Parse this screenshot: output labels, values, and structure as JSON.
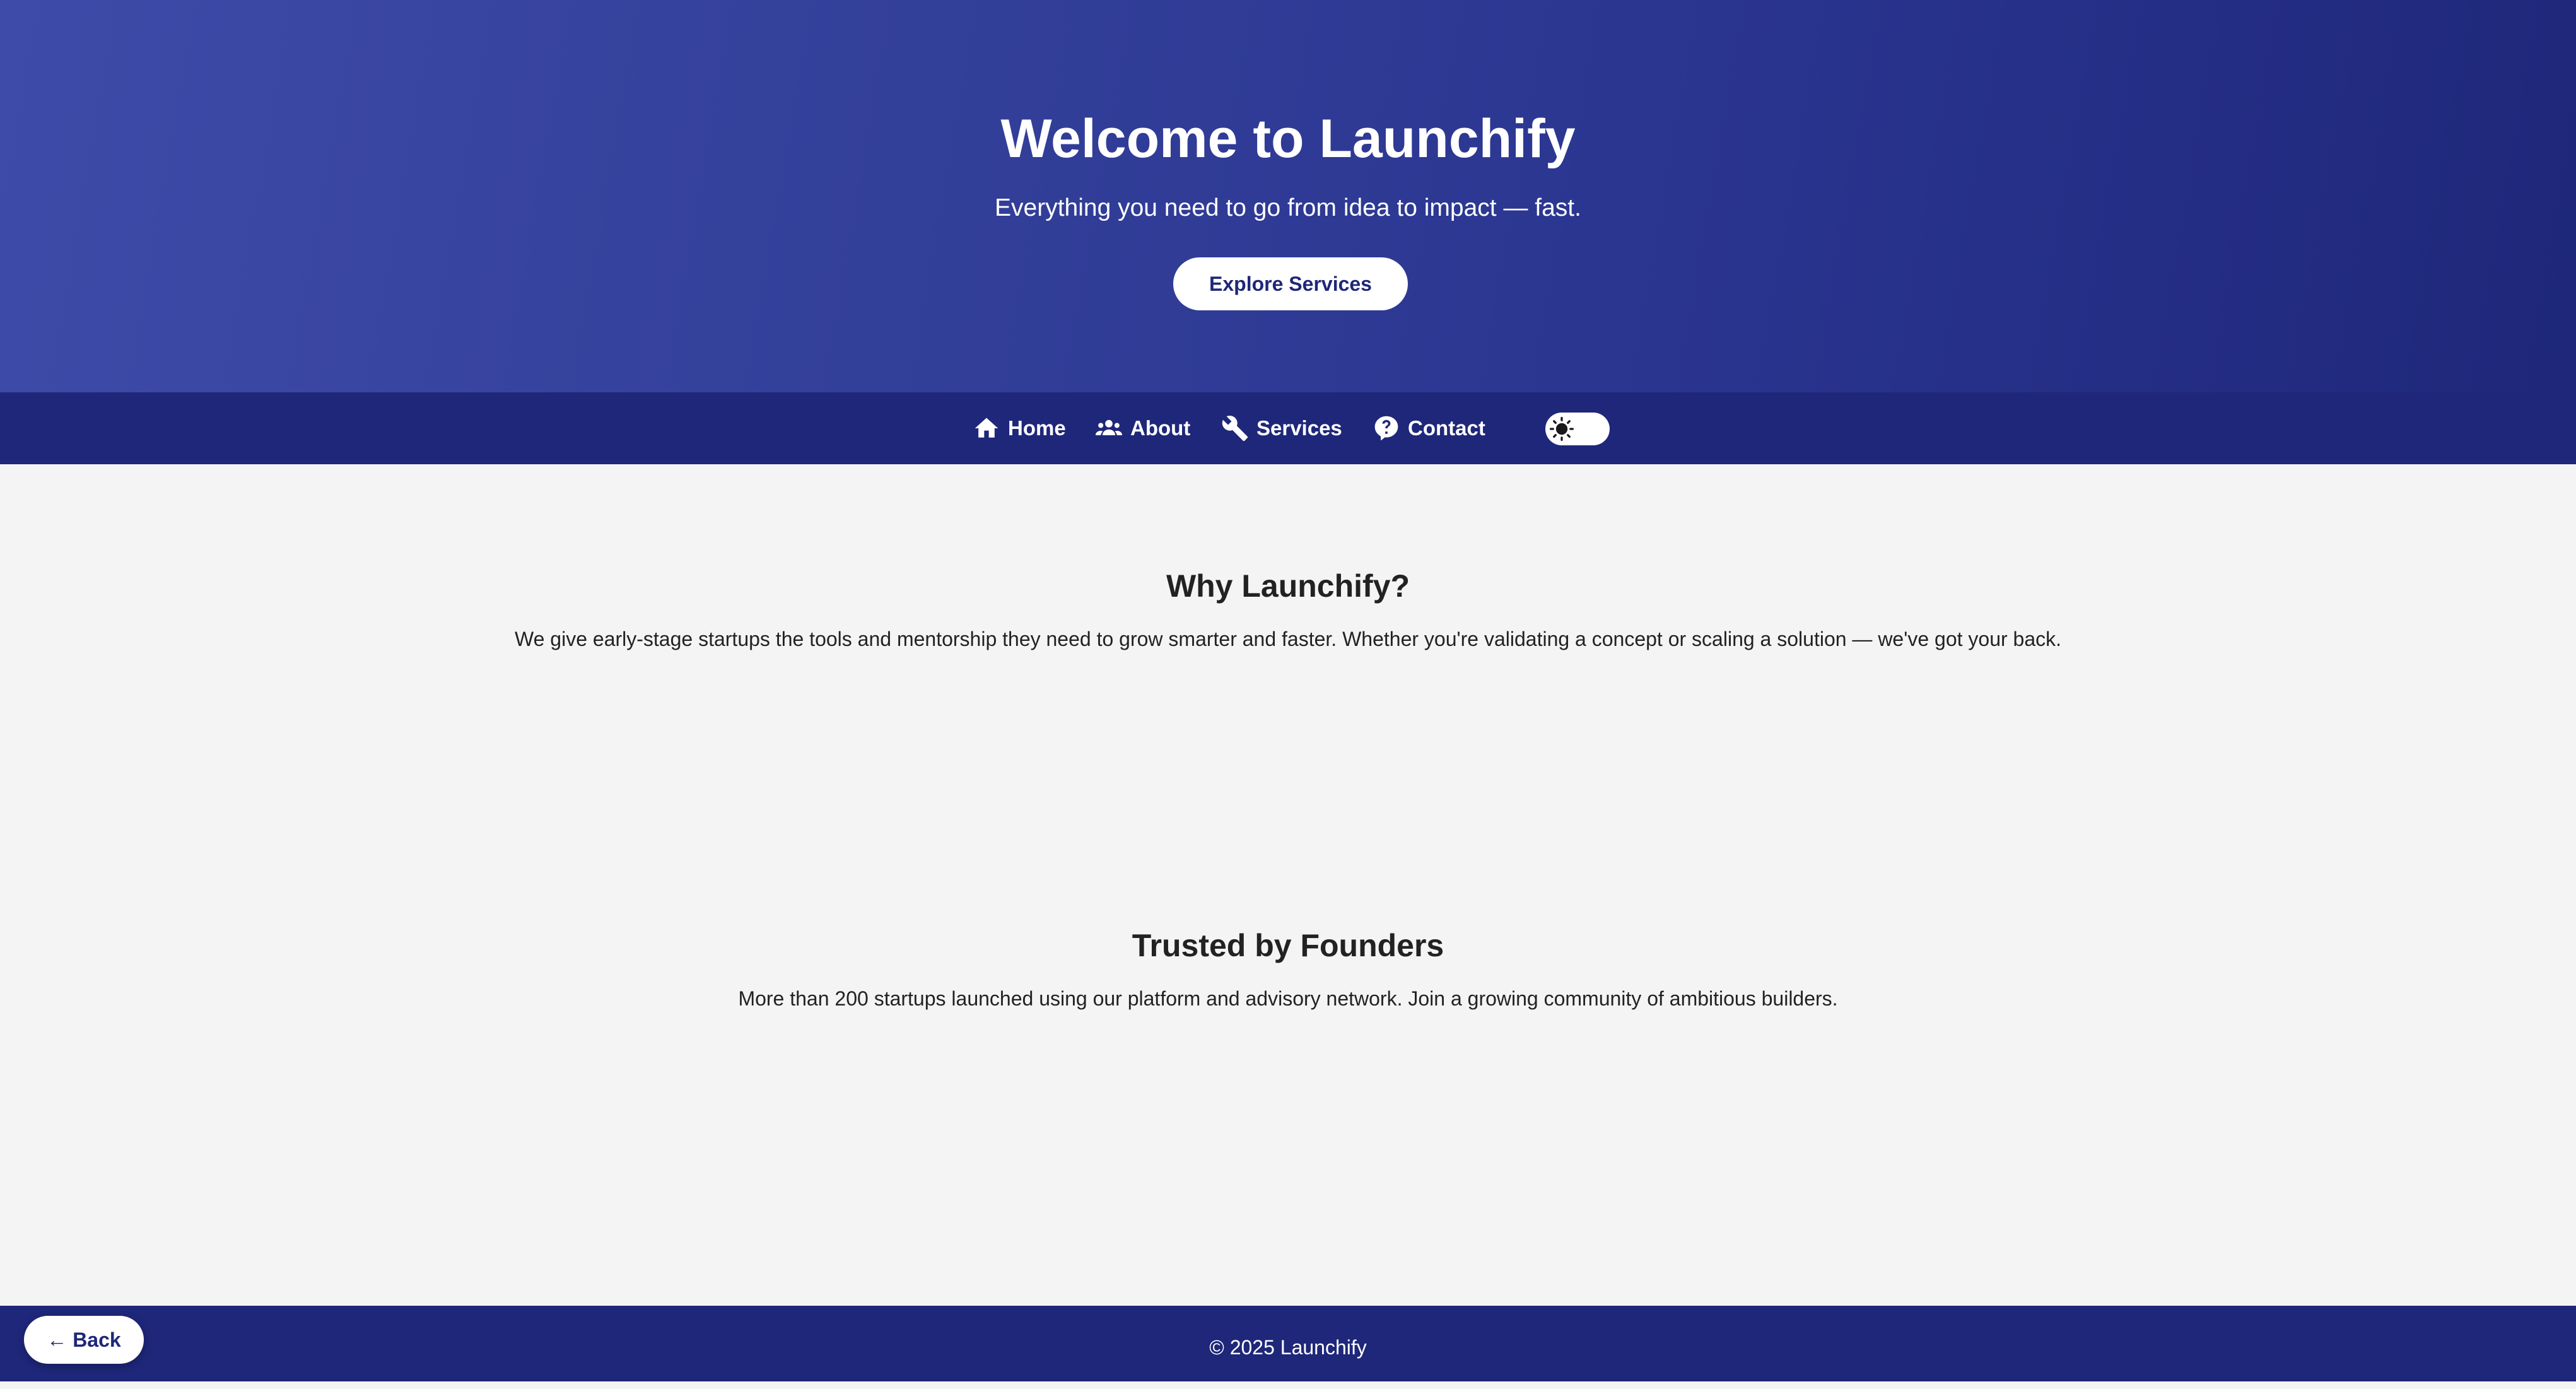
{
  "hero": {
    "title": "Welcome to Launchify",
    "subtitle": "Everything you need to go from idea to impact — fast.",
    "cta_label": "Explore Services"
  },
  "nav": {
    "items": [
      {
        "label": "Home",
        "icon": "home-icon"
      },
      {
        "label": "About",
        "icon": "people-icon"
      },
      {
        "label": "Services",
        "icon": "wrench-icon"
      },
      {
        "label": "Contact",
        "icon": "help-icon"
      }
    ],
    "theme_toggle_icon": "sun-icon"
  },
  "sections": [
    {
      "title": "Why Launchify?",
      "text": "We give early-stage startups the tools and mentorship they need to grow smarter and faster. Whether you're validating a concept or scaling a solution — we've got your back."
    },
    {
      "title": "Trusted by Founders",
      "text": "More than 200 startups launched using our platform and advisory network. Join a growing community of ambitious builders."
    }
  ],
  "footer": {
    "copyright": "© 2025 Launchify",
    "back_label": "← Back"
  },
  "colors": {
    "brand_dark": "#1e2779",
    "hero_light": "#3e4ba8",
    "background": "#f4f4f4",
    "text": "#222222"
  }
}
